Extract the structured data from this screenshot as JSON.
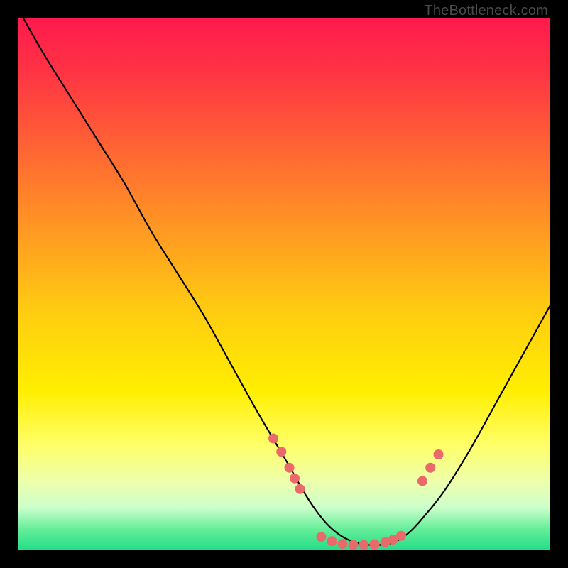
{
  "watermark": "TheBottleneck.com",
  "chart_data": {
    "type": "line",
    "title": "",
    "xlabel": "",
    "ylabel": "",
    "xlim": [
      0,
      100
    ],
    "ylim": [
      0,
      100
    ],
    "series": [
      {
        "name": "bottleneck-curve",
        "x": [
          1,
          5,
          10,
          15,
          20,
          25,
          30,
          35,
          40,
          45,
          50,
          52,
          54,
          56,
          58,
          60,
          62,
          64,
          66,
          68,
          70,
          72,
          74,
          76,
          80,
          85,
          90,
          95,
          100
        ],
        "y": [
          100,
          93,
          85,
          77,
          69,
          60,
          52,
          44,
          35,
          26,
          17.5,
          14,
          10.5,
          7.5,
          5,
          3.2,
          2,
          1.3,
          1,
          1,
          1.3,
          2.2,
          3.8,
          6,
          11,
          19,
          28,
          37,
          46
        ]
      }
    ],
    "markers": {
      "name": "highlight-points",
      "color": "#e96a6a",
      "points": [
        {
          "x": 48,
          "y": 21
        },
        {
          "x": 49.5,
          "y": 18.5
        },
        {
          "x": 51,
          "y": 15.5
        },
        {
          "x": 52,
          "y": 13.5
        },
        {
          "x": 53,
          "y": 11.5
        },
        {
          "x": 57,
          "y": 2.5
        },
        {
          "x": 59,
          "y": 1.7
        },
        {
          "x": 61,
          "y": 1.2
        },
        {
          "x": 63,
          "y": 1
        },
        {
          "x": 65,
          "y": 1
        },
        {
          "x": 67,
          "y": 1.1
        },
        {
          "x": 69,
          "y": 1.5
        },
        {
          "x": 70.5,
          "y": 2
        },
        {
          "x": 72,
          "y": 2.7
        },
        {
          "x": 76,
          "y": 13
        },
        {
          "x": 77.5,
          "y": 15.5
        },
        {
          "x": 79,
          "y": 18
        }
      ]
    }
  }
}
